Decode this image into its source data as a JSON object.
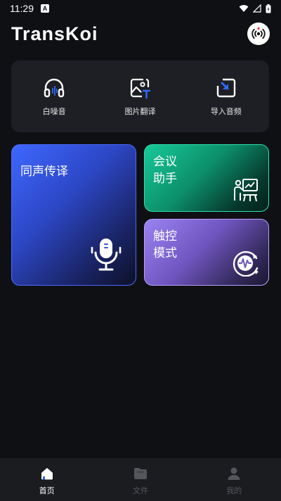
{
  "status_bar": {
    "time": "11:29",
    "notification_letter": "A"
  },
  "header": {
    "logo_text": "TransKoi"
  },
  "tools": [
    {
      "label": "白噪音",
      "icon": "headphones-icon"
    },
    {
      "label": "图片翻译",
      "icon": "image-translate-icon"
    },
    {
      "label": "导入音频",
      "icon": "import-audio-icon"
    }
  ],
  "cards": {
    "simultaneous": {
      "title": "同声传译",
      "icon": "microphone-icon"
    },
    "meeting": {
      "title": "会议\n助手",
      "icon": "presentation-icon"
    },
    "touch": {
      "title": "触控\n模式",
      "icon": "touch-wave-icon"
    }
  },
  "nav": [
    {
      "label": "首页",
      "icon": "home-icon",
      "active": true
    },
    {
      "label": "文件",
      "icon": "folder-icon",
      "active": false
    },
    {
      "label": "我的",
      "icon": "profile-icon",
      "active": false
    }
  ],
  "colors": {
    "background": "#0f1014",
    "panel": "#1e1f24",
    "simultaneous_card": "#3e67ff",
    "meeting_card": "#17c99a",
    "touch_card": "#9a83f2",
    "nav_active": "#ffffff",
    "nav_inactive": "#55565c"
  }
}
